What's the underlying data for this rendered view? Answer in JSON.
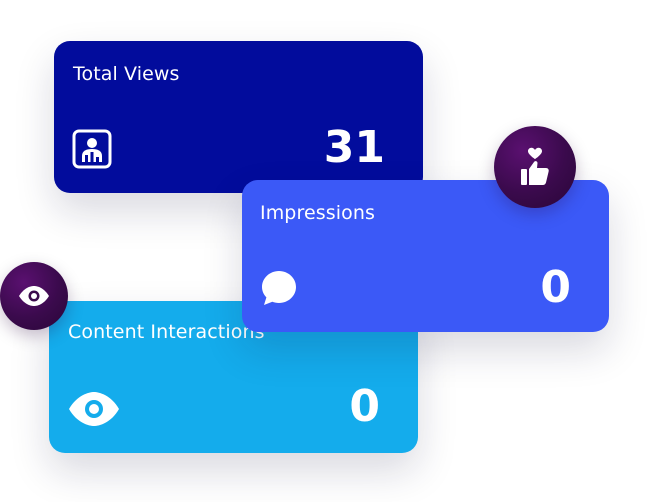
{
  "cards": [
    {
      "title": "Total Views",
      "value": "31",
      "icon": "user-chart-icon",
      "color": "#020c9c"
    },
    {
      "title": "Impressions",
      "value": "0",
      "icon": "speech-bubble-icon",
      "color": "#3b59f7"
    },
    {
      "title": "Content Interactions",
      "value": "0",
      "icon": "eye-icon",
      "color": "#14acec"
    }
  ],
  "badges": [
    {
      "icon": "thumbs-up-heart-icon",
      "color": "#3a0a4c"
    },
    {
      "icon": "eye-icon",
      "color": "#3a0a4c"
    }
  ]
}
